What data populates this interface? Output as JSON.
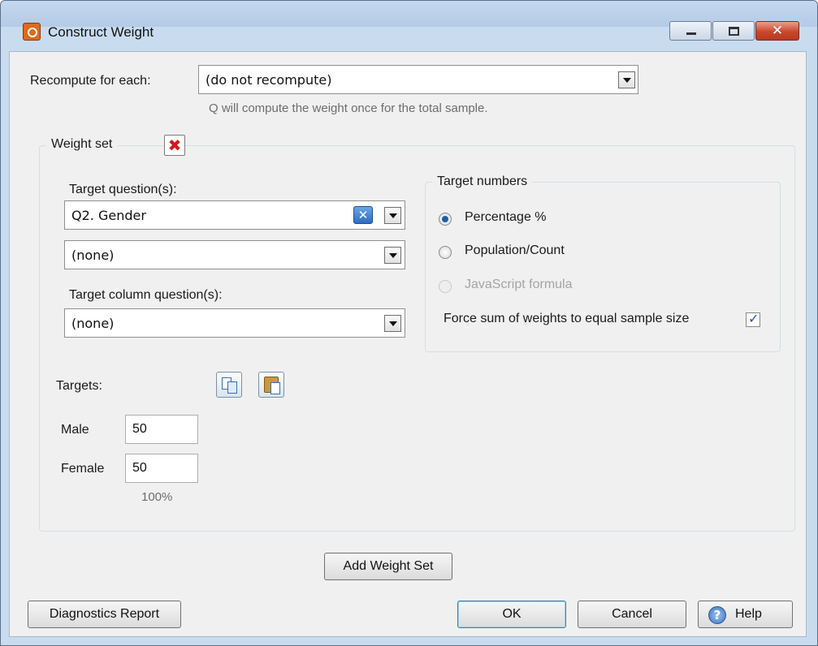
{
  "window": {
    "title": "Construct Weight",
    "controls": [
      "minimize-icon",
      "maximize-icon",
      "close-icon"
    ]
  },
  "recompute": {
    "label": "Recompute for each:",
    "value": "(do not recompute)",
    "hint": "Q will compute the weight once for the total sample."
  },
  "weight_set": {
    "legend": "Weight set",
    "target_questions_label": "Target question(s):",
    "target_question_1": "Q2. Gender",
    "target_question_2": "(none)",
    "target_column_label": "Target column question(s):",
    "target_column_value": "(none)",
    "target_numbers": {
      "legend": "Target numbers",
      "options": [
        {
          "label": "Percentage %",
          "selected": true,
          "enabled": true
        },
        {
          "label": "Population/Count",
          "selected": false,
          "enabled": true
        },
        {
          "label": "JavaScript formula",
          "selected": false,
          "enabled": false
        }
      ],
      "force_sum_label": "Force sum of weights to equal sample size",
      "force_sum_checked": true
    },
    "targets_label": "Targets:",
    "targets": [
      {
        "name": "Male",
        "value": "50"
      },
      {
        "name": "Female",
        "value": "50"
      }
    ],
    "total": "100%"
  },
  "buttons": {
    "add_weight_set": "Add Weight Set",
    "diagnostics": "Diagnostics Report",
    "ok": "OK",
    "cancel": "Cancel",
    "help": "Help"
  },
  "colors": {
    "accent": "#1d5ea8",
    "close_button": "#c9472d",
    "delete_icon": "#d11b1b"
  }
}
